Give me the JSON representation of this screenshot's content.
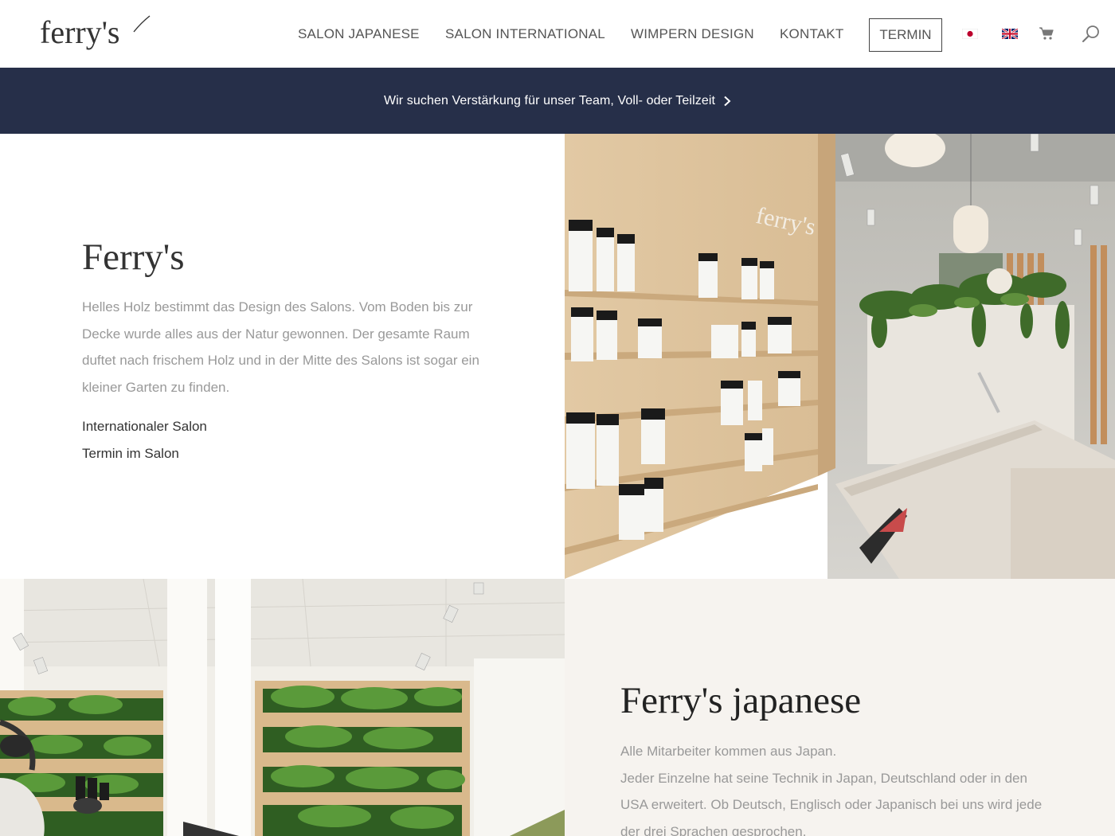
{
  "header": {
    "logo_text": "ferry's",
    "nav": [
      {
        "label": "SALON JAPANESE"
      },
      {
        "label": "SALON INTERNATIONAL"
      },
      {
        "label": "WIMPERN DESIGN"
      },
      {
        "label": "KONTAKT"
      }
    ],
    "termin_label": "TERMIN",
    "icons": [
      "japan-flag-icon",
      "uk-flag-icon",
      "cart-icon",
      "search-icon"
    ]
  },
  "banner": {
    "text": "Wir suchen Verstärkung für unser Team, Voll- oder Teilzeit",
    "background": "#262f49",
    "icon": "chevron-right-icon"
  },
  "section1": {
    "title": "Ferry's",
    "body": "Helles Holz bestimmt das Design des Salons. Vom Boden bis zur Decke wurde alles aus der Natur gewonnen. Der gesamte Raum duftet nach frischem Holz und in der Mitte des Salons ist sogar ein kleiner Garten zu finden.",
    "links": [
      {
        "label": "Internationaler Salon"
      },
      {
        "label": "Termin im Salon"
      }
    ],
    "photo_sign": "ferry's"
  },
  "section2": {
    "title": "Ferry's japanese",
    "body_lines": [
      "Alle Mitarbeiter kommen aus Japan.",
      "Jeder Einzelne hat seine Technik in Japan, Deutschland oder in den USA erweitert. Ob Deutsch, Englisch oder Japanisch bei uns wird jede der drei Sprachen gesprochen."
    ],
    "background": "#f6f3ef"
  }
}
